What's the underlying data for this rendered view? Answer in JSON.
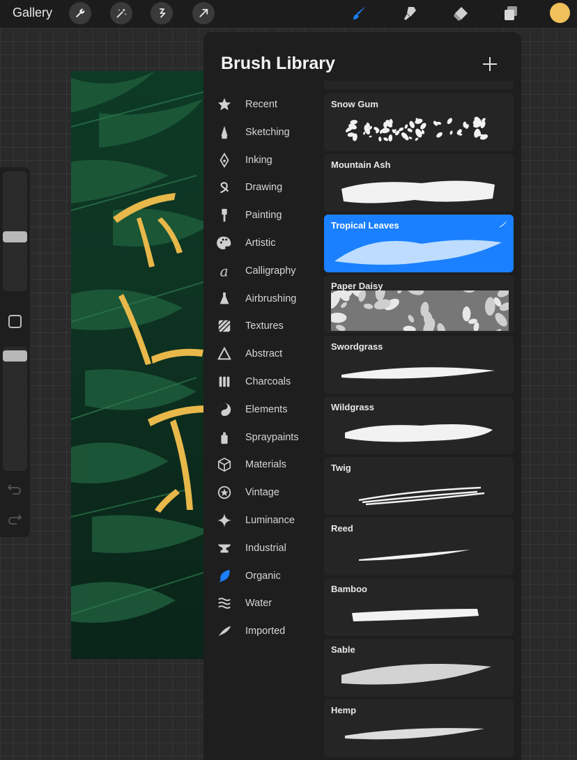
{
  "toolbar": {
    "gallery_label": "Gallery",
    "left_tools": [
      "wrench-icon",
      "magic-wand-icon",
      "selection-icon",
      "transform-arrow-icon"
    ],
    "right_tools": [
      "brush-icon",
      "smudge-icon",
      "eraser-icon",
      "layers-icon"
    ],
    "active_tool": "brush-icon",
    "active_color": "#f0c05a",
    "accent_color": "#1a80ff"
  },
  "panel": {
    "title": "Brush Library",
    "categories": [
      {
        "label": "Recent",
        "icon": "star-icon"
      },
      {
        "label": "Sketching",
        "icon": "pencil-tip-icon"
      },
      {
        "label": "Inking",
        "icon": "pen-nib-icon"
      },
      {
        "label": "Drawing",
        "icon": "squiggle-icon"
      },
      {
        "label": "Painting",
        "icon": "paintbrush-icon"
      },
      {
        "label": "Artistic",
        "icon": "palette-icon"
      },
      {
        "label": "Calligraphy",
        "icon": "calligraphy-icon"
      },
      {
        "label": "Airbrushing",
        "icon": "airbrush-icon"
      },
      {
        "label": "Textures",
        "icon": "texture-icon"
      },
      {
        "label": "Abstract",
        "icon": "triangle-icon"
      },
      {
        "label": "Charcoals",
        "icon": "charcoal-icon"
      },
      {
        "label": "Elements",
        "icon": "yin-yang-icon"
      },
      {
        "label": "Spraypaints",
        "icon": "spraycan-icon"
      },
      {
        "label": "Materials",
        "icon": "cube-icon"
      },
      {
        "label": "Vintage",
        "icon": "vintage-star-icon"
      },
      {
        "label": "Luminance",
        "icon": "sparkle-icon"
      },
      {
        "label": "Industrial",
        "icon": "anvil-icon"
      },
      {
        "label": "Organic",
        "icon": "leaf-icon"
      },
      {
        "label": "Water",
        "icon": "waves-icon"
      },
      {
        "label": "Imported",
        "icon": "feather-icon"
      }
    ],
    "selected_category": "Organic",
    "brushes": [
      {
        "name": "Snow Gum",
        "selected": false
      },
      {
        "name": "Mountain Ash",
        "selected": false
      },
      {
        "name": "Tropical Leaves",
        "selected": true
      },
      {
        "name": "Paper Daisy",
        "selected": false
      },
      {
        "name": "Swordgrass",
        "selected": false
      },
      {
        "name": "Wildgrass",
        "selected": false
      },
      {
        "name": "Twig",
        "selected": false
      },
      {
        "name": "Reed",
        "selected": false
      },
      {
        "name": "Bamboo",
        "selected": false
      },
      {
        "name": "Sable",
        "selected": false
      },
      {
        "name": "Hemp",
        "selected": false
      }
    ]
  },
  "sidebar": {
    "brush_size_level": 0.45,
    "opacity_level": 0.97
  }
}
